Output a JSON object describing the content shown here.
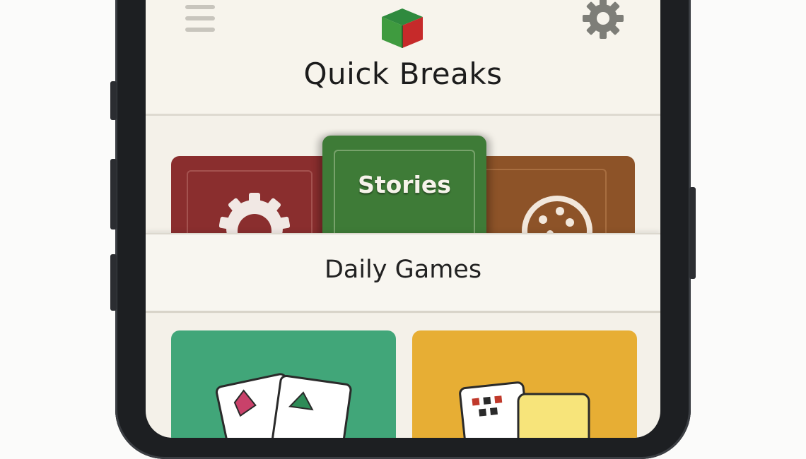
{
  "app": {
    "title": "Quick Breaks",
    "icons": {
      "menu": "hamburger-menu-icon",
      "logo": "cube-logo-icon",
      "settings": "gear-icon"
    }
  },
  "carousel": {
    "active_label": "Stories",
    "cards": [
      {
        "id": "left",
        "icon": "gear-icon",
        "color": "#8a2e2e"
      },
      {
        "id": "center",
        "label": "Stories",
        "color": "#3e7b37"
      },
      {
        "id": "right",
        "icon": "cookie-icon",
        "color": "#8d5328"
      }
    ]
  },
  "section": {
    "title": "Daily Games"
  },
  "tiles": [
    {
      "id": "cards-game",
      "icon": "playing-cards-icon",
      "color": "#41a679"
    },
    {
      "id": "board-game",
      "icon": "dice-board-icon",
      "color": "#e7ae34"
    }
  ],
  "colors": {
    "background": "#f4f1e9",
    "accent_green": "#3e7b37",
    "accent_red": "#8a2e2e"
  }
}
